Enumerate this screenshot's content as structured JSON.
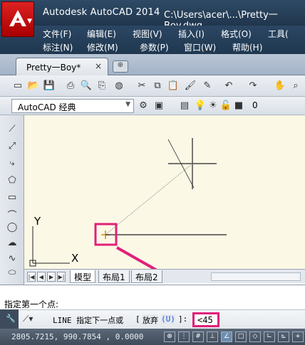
{
  "titlebar": {
    "app_title": "Autodesk AutoCAD 2014",
    "file_path": "C:\\Users\\acer\\...\\Pretty一Boy.dwg",
    "app_button_letter": "A"
  },
  "menubar": {
    "row1": [
      "文件(F)",
      "编辑(E)",
      "视图(V)",
      "插入(I)",
      "格式(O)",
      "工具("
    ],
    "row2": [
      "标注(N)",
      "修改(M)",
      "参数(P)",
      "窗口(W)",
      "帮助(H)"
    ]
  },
  "tabs": {
    "document_tab": "Pretty一Boy*",
    "close_glyph": "×"
  },
  "toolbar": {
    "workspace": "AutoCAD 经典",
    "layer_value": "0"
  },
  "canvas": {
    "ucs_y": "Y",
    "ucs_x": "X"
  },
  "layout_tabs": {
    "model": "模型",
    "layout1": "布局1",
    "layout2": "布局2"
  },
  "command": {
    "history_line": "指定第一个点:",
    "prompt": "LINE 指定下一点或",
    "option_open": "[",
    "option_label": "放弃",
    "option_key": "(U)",
    "option_close": "]:",
    "input_value": "<45"
  },
  "statusbar": {
    "coordinates": "2805.7215, 990.7854 , 0.0000"
  },
  "colors": {
    "highlight": "#e0207a",
    "canvas_bg": "#fcf8e6",
    "title_bg": "#2e4a66"
  }
}
